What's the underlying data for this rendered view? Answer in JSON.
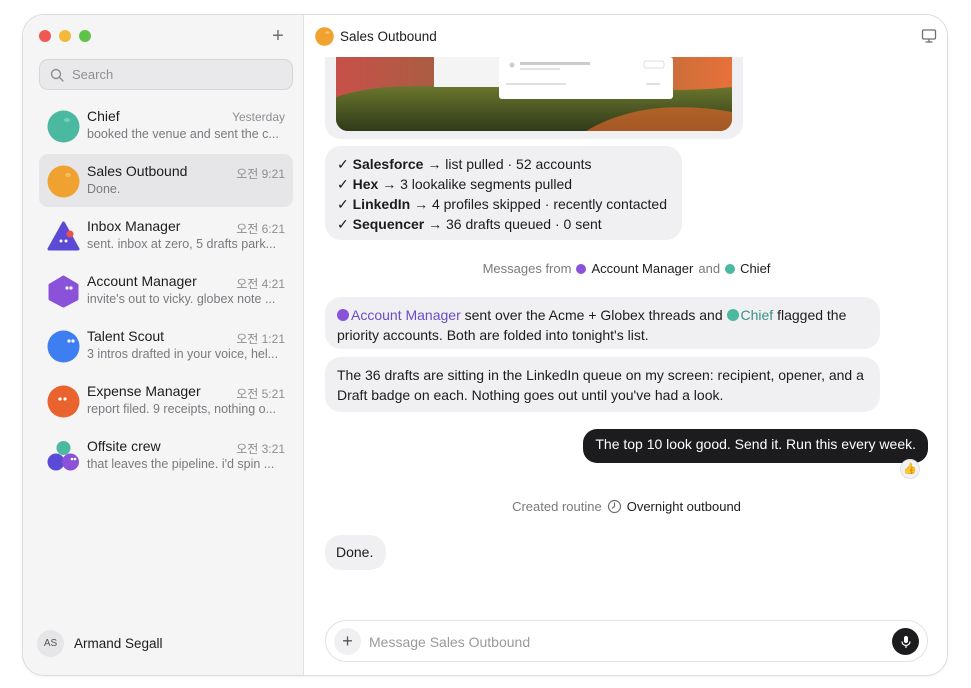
{
  "sidebar": {
    "search_placeholder": "Search",
    "chats": [
      {
        "name": "Chief",
        "time": "Yesterday",
        "preview": "booked the venue and sent the c...",
        "color": "#4bb8a0"
      },
      {
        "name": "Sales Outbound",
        "time": "오전 9:21",
        "preview": "Done.",
        "color": "#f0a230"
      },
      {
        "name": "Inbox Manager",
        "time": "오전 6:21",
        "preview": "sent. inbox at zero, 5 drafts park...",
        "color": "#5b4ad6"
      },
      {
        "name": "Account Manager",
        "time": "오전 4:21",
        "preview": "invite's out to vicky. globex note ...",
        "color": "#8a52d9"
      },
      {
        "name": "Talent Scout",
        "time": "오전 1:21",
        "preview": "3 intros drafted in your voice, hel...",
        "color": "#3d7ef0"
      },
      {
        "name": "Expense Manager",
        "time": "오전 5:21",
        "preview": "report filed. 9 receipts, nothing o...",
        "color": "#e8632e"
      },
      {
        "name": "Offsite crew",
        "time": "오전 3:21",
        "preview": "that leaves the pipeline. i'd spin ...",
        "color": "#6b4ad8"
      }
    ],
    "user": {
      "initials": "AS",
      "name": "Armand Segall"
    }
  },
  "header": {
    "title": "Sales Outbound"
  },
  "messages": {
    "checklist": [
      {
        "check": "✓",
        "tool": "Salesforce",
        "detail": "→ list pulled · 52 accounts"
      },
      {
        "check": "✓",
        "tool": "Hex",
        "detail": "→ 3 lookalike segments pulled"
      },
      {
        "check": "✓",
        "tool": "LinkedIn",
        "detail": "→ 4 profiles skipped · recently contacted"
      },
      {
        "check": "✓",
        "tool": "Sequencer",
        "detail": "→ 36 drafts queued · 0 sent"
      }
    ],
    "messages_from": {
      "prefix": "Messages from",
      "agent1": "Account Manager",
      "conj": "and",
      "agent2": "Chief"
    },
    "msg1": {
      "mention1": "Account Manager",
      "part1": " sent over the Acme + Globex threads and ",
      "mention2": "Chief",
      "part2": " flagged the priority accounts. Both are folded into tonight's list."
    },
    "msg2": "The 36 drafts are sitting in the LinkedIn queue on my screen: recipient, opener, and a Draft badge on each. Nothing goes out until you've had a look.",
    "outgoing": "The top 10 look good. Send it. Run this every week.",
    "reaction": "👍",
    "routine": {
      "prefix": "Created routine",
      "name": "Overnight outbound"
    },
    "done": "Done."
  },
  "composer": {
    "placeholder": "Message Sales Outbound"
  },
  "colors": {
    "accent_purple": "#6a4cc7",
    "accent_teal": "#3a8f88",
    "dark": "#1c1c1e"
  }
}
